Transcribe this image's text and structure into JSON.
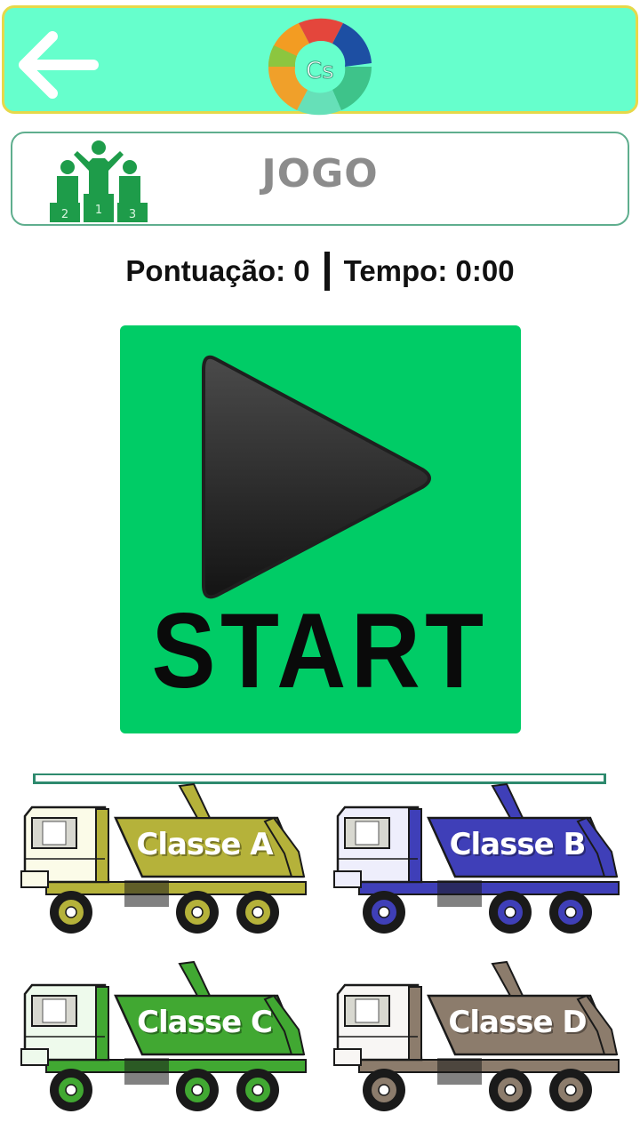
{
  "header": {
    "back_icon": "arrow-left-icon",
    "logo_text": "Cs",
    "background": "#66ffcc",
    "border": "#e6d84a"
  },
  "title_box": {
    "icon": "podium-icon",
    "podium_numbers": [
      "2",
      "1",
      "3"
    ],
    "title": "JOGO"
  },
  "status": {
    "score_label": "Pontuação: 0",
    "time_label": "Tempo: 0:00"
  },
  "start_button": {
    "label": "START",
    "icon": "play-icon",
    "background": "#00cc66"
  },
  "classes": [
    {
      "label": "Classe A",
      "color": "#b5b23a",
      "cab": "#fbfbe8"
    },
    {
      "label": "Classe B",
      "color": "#3f3fb8",
      "cab": "#eeeefc"
    },
    {
      "label": "Classe C",
      "color": "#41a832",
      "cab": "#eefaec"
    },
    {
      "label": "Classe D",
      "color": "#8c7c6c",
      "cab": "#f8f6f4"
    }
  ]
}
